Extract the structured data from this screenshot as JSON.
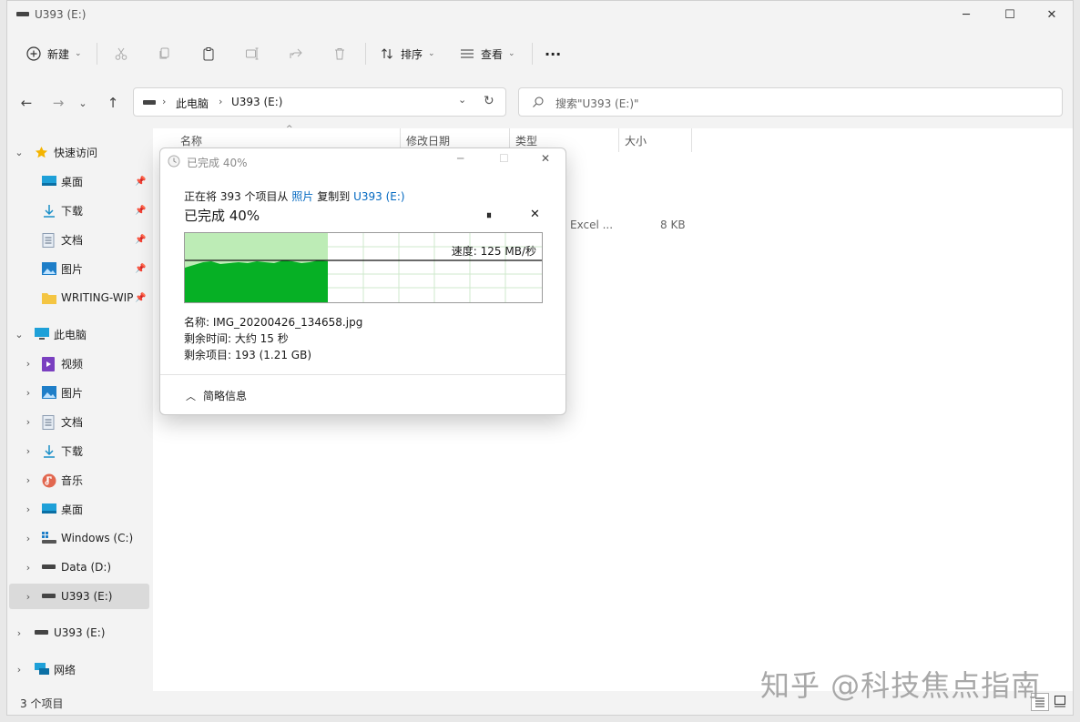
{
  "window": {
    "title": "U393 (E:)",
    "minimize": "─",
    "maximize": "☐",
    "close": "✕"
  },
  "toolbar": {
    "new_label": "新建",
    "sort_label": "排序",
    "view_label": "查看",
    "more_label": "···"
  },
  "address": {
    "back": "←",
    "forward": "→",
    "recent": "⌄",
    "up": "↑",
    "crumbs": [
      "此电脑",
      "U393 (E:)"
    ],
    "search_placeholder": "搜索\"U393 (E:)\""
  },
  "sidebar": {
    "quick_access": "快速访问",
    "quick_items": [
      "桌面",
      "下载",
      "文档",
      "图片",
      "WRITING-WIP"
    ],
    "this_pc": "此电脑",
    "pc_items": [
      "视频",
      "图片",
      "文档",
      "下载",
      "音乐",
      "桌面",
      "Windows (C:)",
      "Data (D:)",
      "U393 (E:)"
    ],
    "usb_drive": "U393 (E:)",
    "network": "网络"
  },
  "columns": {
    "name": "名称",
    "date": "修改日期",
    "type": "类型",
    "size": "大小"
  },
  "file_row": {
    "type": "Excel ...",
    "size": "8 KB"
  },
  "status": {
    "count": "3 个项目"
  },
  "dialog": {
    "title": "已完成 40%",
    "copy_prefix": "正在将 393 个项目从",
    "source": "照片",
    "copy_mid": "复制到",
    "dest": "U393 (E:)",
    "progress_heading": "已完成 40%",
    "progress": 0.4,
    "speed": "速度: 125 MB/秒",
    "name_line": "名称: IMG_20200426_134658.jpg",
    "time_line": "剩余时间: 大约 15 秒",
    "items_line": "剩余项目: 193 (1.21 GB)",
    "details_toggle": "简略信息",
    "pause_icon": "⏸",
    "cancel_icon": "✕"
  },
  "watermark": "知乎 @科技焦点指南",
  "colors": {
    "accent": "#0067c0",
    "progress_fill": "#06b025",
    "progress_bg": "#bdecb6",
    "folder": "#f4c542"
  }
}
